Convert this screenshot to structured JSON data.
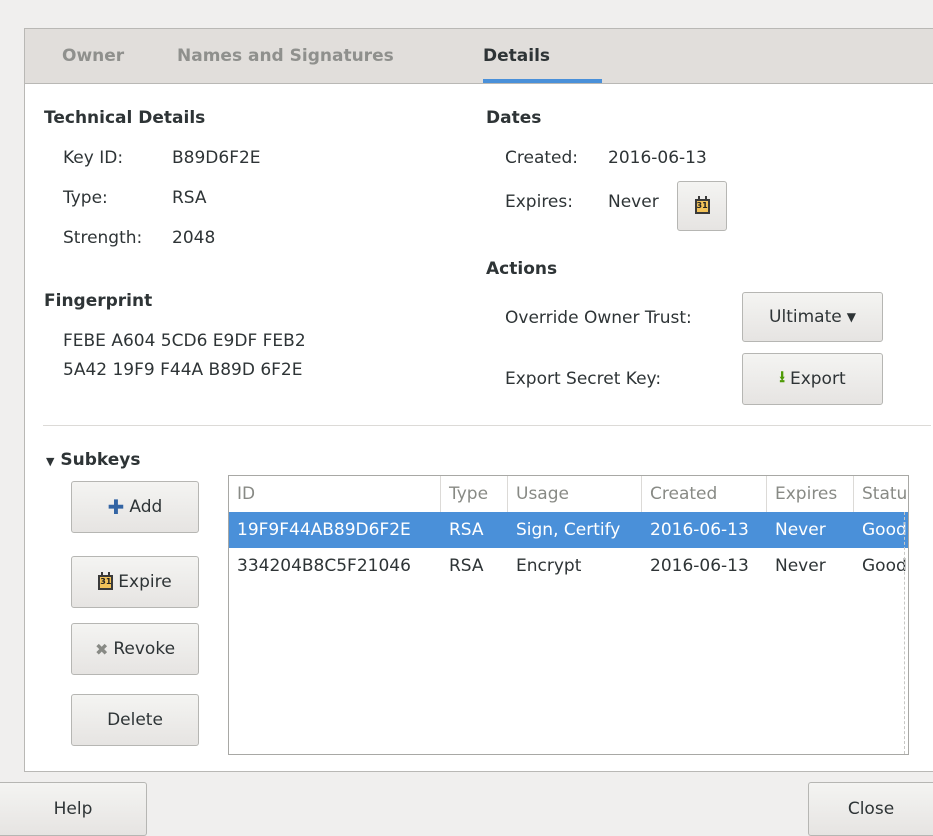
{
  "tabs": [
    {
      "label": "Owner"
    },
    {
      "label": "Names and Signatures"
    },
    {
      "label": "Details"
    }
  ],
  "technical": {
    "heading": "Technical Details",
    "key_id_label": "Key ID:",
    "key_id_value": "B89D6F2E",
    "type_label": "Type:",
    "type_value": "RSA",
    "strength_label": "Strength:",
    "strength_value": "2048"
  },
  "fingerprint": {
    "heading": "Fingerprint",
    "line1": "FEBE A604 5CD6 E9DF FEB2",
    "line2": "5A42 19F9 F44A B89D 6F2E"
  },
  "dates": {
    "heading": "Dates",
    "created_label": "Created:",
    "created_value": "2016-06-13",
    "expires_label": "Expires:",
    "expires_value": "Never",
    "calendar_icon_text": "31"
  },
  "actions": {
    "heading": "Actions",
    "override_label": "Override Owner Trust:",
    "override_value": "Ultimate",
    "export_label": "Export Secret Key:",
    "export_button": "Export"
  },
  "subkeys": {
    "heading": "Subkeys",
    "add_button": "Add",
    "expire_button": "Expire",
    "revoke_button": "Revoke",
    "delete_button": "Delete",
    "columns": [
      "ID",
      "Type",
      "Usage",
      "Created",
      "Expires",
      "Status"
    ],
    "rows": [
      {
        "id": "19F9F44AB89D6F2E",
        "type": "RSA",
        "usage": "Sign, Certify",
        "created": "2016-06-13",
        "expires": "Never",
        "status": "Good",
        "selected": true
      },
      {
        "id": "334204B8C5F21046",
        "type": "RSA",
        "usage": "Encrypt",
        "created": "2016-06-13",
        "expires": "Never",
        "status": "Good",
        "selected": false
      }
    ]
  },
  "footer": {
    "help_button": "Help",
    "close_button": "Close"
  },
  "colors": {
    "accent": "#4a90d9",
    "selection_text": "#ffffff",
    "window_bg": "#f0efee"
  }
}
